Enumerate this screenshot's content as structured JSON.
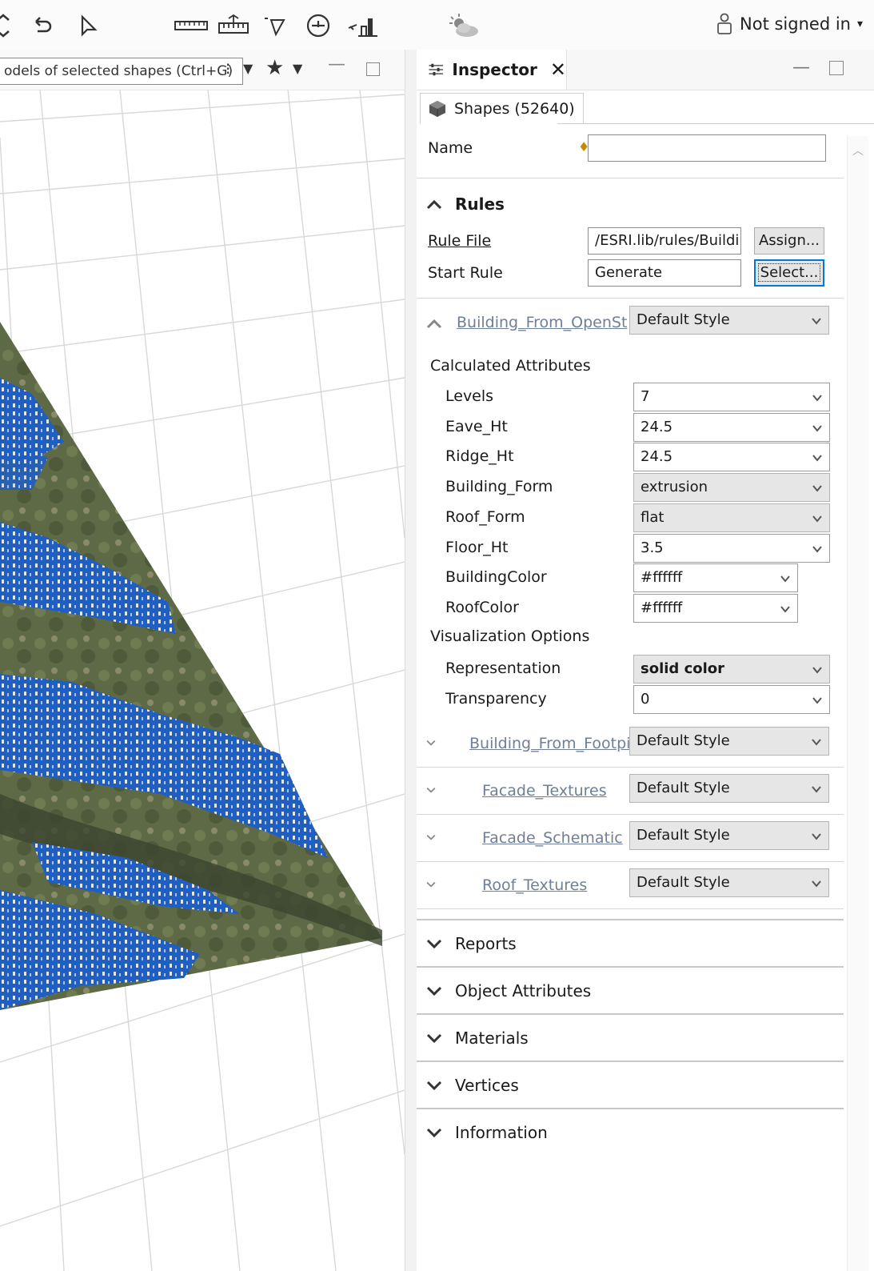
{
  "toolbar": {
    "icons": [
      "move-icon",
      "undo-icon",
      "select-cursor-icon",
      "ruler-icon",
      "dimension-ruler-icon",
      "lasso-icon",
      "orbit-icon",
      "terrain-icon",
      "weather-icon"
    ],
    "user": {
      "label": "Not signed in",
      "icon": "user-icon"
    }
  },
  "viewport": {
    "tooltip": "odels of selected shapes (Ctrl+G)",
    "icons": [
      "dropdown-arrow-icon",
      "star-icon",
      "minimize-icon",
      "maximize-icon"
    ]
  },
  "inspector": {
    "tab_title": "Inspector",
    "shapes_tab": "Shapes (52640)",
    "name_label": "Name",
    "name_value": "",
    "rules": {
      "title": "Rules",
      "rule_file_label": "Rule File",
      "rule_file_value": "/ESRI.lib/rules/Buildi",
      "assign_button": "Assign...",
      "start_rule_label": "Start Rule",
      "start_rule_value": "Generate",
      "select_button": "Select..."
    },
    "osm_group": {
      "link": "Building_From_OpenSt",
      "style": "Default Style",
      "calculated_title": "Calculated Attributes",
      "attributes": [
        {
          "label": "Levels",
          "value": "7",
          "gray": false
        },
        {
          "label": "Eave_Ht",
          "value": "24.5",
          "gray": false
        },
        {
          "label": "Ridge_Ht",
          "value": "24.5",
          "gray": false
        },
        {
          "label": "Building_Form",
          "value": "extrusion",
          "gray": true
        },
        {
          "label": "Roof_Form",
          "value": "flat",
          "gray": true
        },
        {
          "label": "Floor_Ht",
          "value": "3.5",
          "gray": false
        },
        {
          "label": "BuildingColor",
          "value": "#ffffff",
          "gray": false
        },
        {
          "label": "RoofColor",
          "value": "#ffffff",
          "gray": false
        }
      ],
      "visualization_title": "Visualization Options",
      "visualization": [
        {
          "label": "Representation",
          "value": "solid color",
          "gray": true
        },
        {
          "label": "Transparency",
          "value": "0",
          "gray": false
        }
      ]
    },
    "sub_groups": [
      {
        "link": "Building_From_Footpi",
        "style": "Default Style"
      },
      {
        "link": "Facade_Textures",
        "style": "Default Style"
      },
      {
        "link": "Facade_Schematic",
        "style": "Default Style"
      },
      {
        "link": "Roof_Textures",
        "style": "Default Style"
      }
    ],
    "sections": [
      "Reports",
      "Object Attributes",
      "Materials",
      "Vertices",
      "Information"
    ]
  },
  "colors": {
    "building_blue": "#1f5fc4",
    "focus_blue": "#0078d7",
    "link_gray": "#6e7f96"
  }
}
